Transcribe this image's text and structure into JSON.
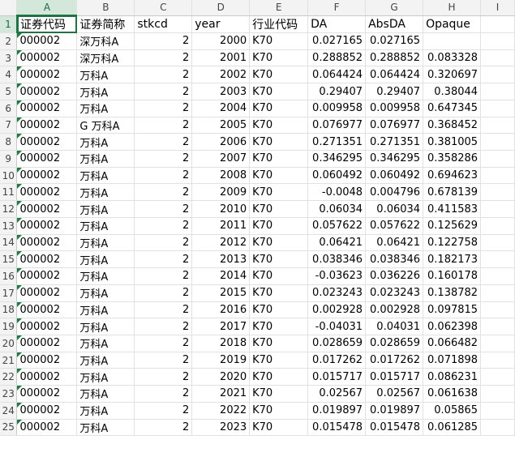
{
  "columns": [
    "A",
    "B",
    "C",
    "D",
    "E",
    "F",
    "G",
    "H",
    "I"
  ],
  "header_row": [
    "证券代码",
    "证券简称",
    "stkcd",
    "year",
    "行业代码",
    "DA",
    "AbsDA",
    "Opaque"
  ],
  "rows": [
    [
      "000002",
      "深万科A",
      "2",
      "2000",
      "K70",
      "0.027165",
      "0.027165",
      ""
    ],
    [
      "000002",
      "深万科A",
      "2",
      "2001",
      "K70",
      "0.288852",
      "0.288852",
      "0.083328"
    ],
    [
      "000002",
      "万科A",
      "2",
      "2002",
      "K70",
      "0.064424",
      "0.064424",
      "0.320697"
    ],
    [
      "000002",
      "万科A",
      "2",
      "2003",
      "K70",
      "0.29407",
      "0.29407",
      "0.38044"
    ],
    [
      "000002",
      "万科A",
      "2",
      "2004",
      "K70",
      "0.009958",
      "0.009958",
      "0.647345"
    ],
    [
      "000002",
      "G 万科A",
      "2",
      "2005",
      "K70",
      "0.076977",
      "0.076977",
      "0.368452"
    ],
    [
      "000002",
      "万科A",
      "2",
      "2006",
      "K70",
      "0.271351",
      "0.271351",
      "0.381005"
    ],
    [
      "000002",
      "万科A",
      "2",
      "2007",
      "K70",
      "0.346295",
      "0.346295",
      "0.358286"
    ],
    [
      "000002",
      "万科A",
      "2",
      "2008",
      "K70",
      "0.060492",
      "0.060492",
      "0.694623"
    ],
    [
      "000002",
      "万科A",
      "2",
      "2009",
      "K70",
      "-0.0048",
      "0.004796",
      "0.678139"
    ],
    [
      "000002",
      "万科A",
      "2",
      "2010",
      "K70",
      "0.06034",
      "0.06034",
      "0.411583"
    ],
    [
      "000002",
      "万科A",
      "2",
      "2011",
      "K70",
      "0.057622",
      "0.057622",
      "0.125629"
    ],
    [
      "000002",
      "万科A",
      "2",
      "2012",
      "K70",
      "0.06421",
      "0.06421",
      "0.122758"
    ],
    [
      "000002",
      "万科A",
      "2",
      "2013",
      "K70",
      "0.038346",
      "0.038346",
      "0.182173"
    ],
    [
      "000002",
      "万科A",
      "2",
      "2014",
      "K70",
      "-0.03623",
      "0.036226",
      "0.160178"
    ],
    [
      "000002",
      "万科A",
      "2",
      "2015",
      "K70",
      "0.023243",
      "0.023243",
      "0.138782"
    ],
    [
      "000002",
      "万科A",
      "2",
      "2016",
      "K70",
      "0.002928",
      "0.002928",
      "0.097815"
    ],
    [
      "000002",
      "万科A",
      "2",
      "2017",
      "K70",
      "-0.04031",
      "0.04031",
      "0.062398"
    ],
    [
      "000002",
      "万科A",
      "2",
      "2018",
      "K70",
      "0.028659",
      "0.028659",
      "0.066482"
    ],
    [
      "000002",
      "万科A",
      "2",
      "2019",
      "K70",
      "0.017262",
      "0.017262",
      "0.071898"
    ],
    [
      "000002",
      "万科A",
      "2",
      "2020",
      "K70",
      "0.015717",
      "0.015717",
      "0.086231"
    ],
    [
      "000002",
      "万科A",
      "2",
      "2021",
      "K70",
      "0.02567",
      "0.02567",
      "0.061638"
    ],
    [
      "000002",
      "万科A",
      "2",
      "2022",
      "K70",
      "0.019897",
      "0.019897",
      "0.05865"
    ],
    [
      "000002",
      "万科A",
      "2",
      "2023",
      "K70",
      "0.015478",
      "0.015478",
      "0.061285"
    ]
  ],
  "selected_column": "A",
  "selected_row": "1",
  "colors": {
    "selection": "#217346",
    "header_bg": "#f3f3f3",
    "selected_header_bg": "#d3e7da",
    "gridline": "#e1e1e1",
    "error_flag": "#1e7b45"
  }
}
